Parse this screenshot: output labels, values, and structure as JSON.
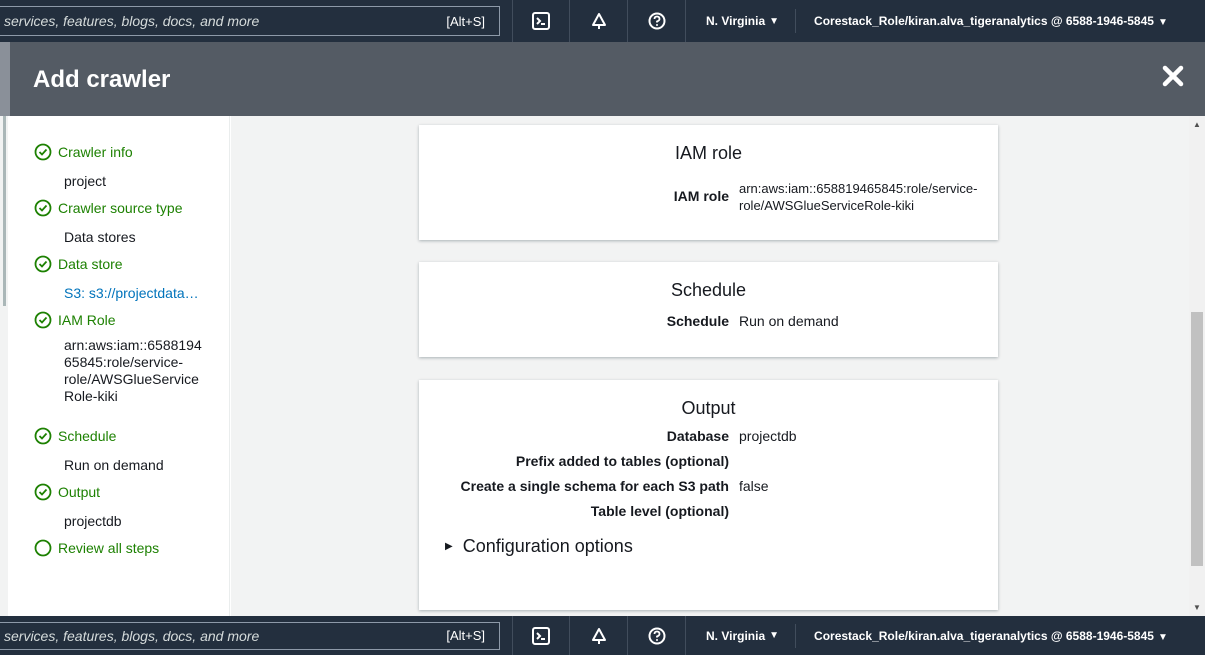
{
  "topnav": {
    "search_placeholder": "services, features, blogs, docs, and more",
    "shortcut": "[Alt+S]",
    "region": "N. Virginia",
    "account": "Corestack_Role/kiran.alva_tigeranalytics @ 6588-1946-5845",
    "icons": [
      "cloudshell-icon",
      "bell-icon",
      "help-icon"
    ]
  },
  "modal": {
    "title": "Add crawler"
  },
  "steps": [
    {
      "label": "Crawler info",
      "value": "project"
    },
    {
      "label": "Crawler source type",
      "value": "Data stores"
    },
    {
      "label": "Data store",
      "value": "S3: s3://projectdata…"
    },
    {
      "label": "IAM Role",
      "value_lines": [
        "arn:aws:iam::6588194",
        "65845:role/service-",
        "role/AWSGlueService",
        "Role-kiki"
      ]
    },
    {
      "label": "Schedule",
      "value": "Run on demand"
    },
    {
      "label": "Output",
      "value": "projectdb"
    },
    {
      "label": "Review all steps"
    }
  ],
  "cards": {
    "iam": {
      "title": "IAM role",
      "key": "IAM role",
      "value_lines": [
        "arn:aws:iam::658819465845:role/service-",
        "role/AWSGlueServiceRole-kiki"
      ]
    },
    "schedule": {
      "title": "Schedule",
      "key": "Schedule",
      "value": "Run on demand"
    },
    "output": {
      "title": "Output",
      "rows": [
        {
          "key": "Database",
          "value": "projectdb"
        },
        {
          "key": "Prefix added to tables (optional)",
          "value": ""
        },
        {
          "key": "Create a single schema for each S3 path",
          "value": "false"
        },
        {
          "key": "Table level (optional)",
          "value": ""
        }
      ],
      "config_label": "Configuration options"
    }
  },
  "colors": {
    "nav_bg": "#232f3e",
    "header_bg": "#545b64",
    "success_green": "#1d8102",
    "link_blue": "#0073bb"
  }
}
